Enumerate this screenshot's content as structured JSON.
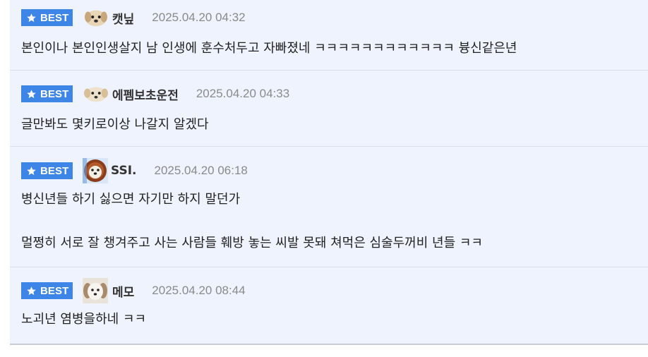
{
  "badge_label": "BEST",
  "colors": {
    "badge_bg": "#3d85e6",
    "card_bg": "#eef3fd",
    "date_text": "#8a8a8a"
  },
  "comments": [
    {
      "nickname": "캣닢",
      "date": "2025.04.20 04:32",
      "avatar": "puppy-avatar-icon",
      "lines": [
        "본인이나 본인인생살지 남 인생에 훈수처두고 자빠졌네 ㅋㅋㅋㅋㅋㅋㅋㅋㅋㅋㅋㅋ 븅신같은년"
      ]
    },
    {
      "nickname": "에펨보초운전",
      "date": "2025.04.20 04:33",
      "avatar": "puppy-avatar-icon",
      "lines": [
        "글만봐도 몇키로이상 나갈지 알겠다"
      ]
    },
    {
      "nickname": "SSI.",
      "date": "2025.04.20 06:18",
      "avatar": "lion-puppy-avatar-icon",
      "lines": [
        "병신년들 하기 싫으면 자기만 하지 말던가",
        "멀쩡히 서로 잘 챙겨주고 사는 사람들 훼방 놓는 씨발 못돼 쳐먹은 심술두꺼비 년들 ㅋㅋ"
      ]
    },
    {
      "nickname": "메모",
      "date": "2025.04.20 08:44",
      "avatar": "white-puppy-avatar-icon",
      "lines": [
        "노괴년 염병을하네 ㅋㅋ"
      ]
    }
  ]
}
